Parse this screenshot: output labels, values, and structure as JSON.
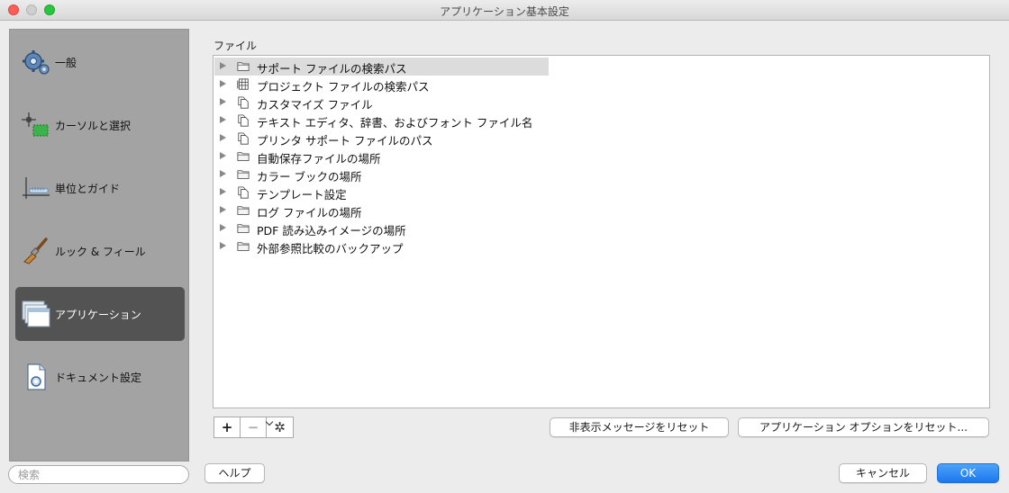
{
  "window": {
    "title": "アプリケーション基本設定"
  },
  "sidebar": {
    "items": [
      {
        "label": "一般",
        "icon": "gear-icon",
        "selected": false
      },
      {
        "label": "カーソルと選択",
        "icon": "cursor-selection-icon",
        "selected": false
      },
      {
        "label": "単位とガイド",
        "icon": "units-guides-icon",
        "selected": false
      },
      {
        "label": "ルック & フィール",
        "icon": "brush-icon",
        "selected": false
      },
      {
        "label": "アプリケーション",
        "icon": "application-windows-icon",
        "selected": true
      },
      {
        "label": "ドキュメント設定",
        "icon": "document-settings-icon",
        "selected": false
      }
    ],
    "search_placeholder": "検索"
  },
  "files": {
    "section_label": "ファイル",
    "rows": [
      {
        "label": "サポート ファイルの検索パス",
        "icon": "folder-icon",
        "selected": true
      },
      {
        "label": "プロジェクト ファイルの検索パス",
        "icon": "project-icon",
        "selected": false
      },
      {
        "label": "カスタマイズ ファイル",
        "icon": "files-icon",
        "selected": false
      },
      {
        "label": "テキスト エディタ、辞書、およびフォント ファイル名",
        "icon": "files-icon",
        "selected": false
      },
      {
        "label": "プリンタ サポート ファイルのパス",
        "icon": "files-icon",
        "selected": false
      },
      {
        "label": "自動保存ファイルの場所",
        "icon": "folder-icon",
        "selected": false
      },
      {
        "label": "カラー ブックの場所",
        "icon": "folder-icon",
        "selected": false
      },
      {
        "label": "テンプレート設定",
        "icon": "files-icon",
        "selected": false
      },
      {
        "label": "ログ ファイルの場所",
        "icon": "folder-icon",
        "selected": false
      },
      {
        "label": "PDF 読み込みイメージの場所",
        "icon": "folder-icon",
        "selected": false
      },
      {
        "label": "外部参照比較のバックアップ",
        "icon": "folder-icon",
        "selected": false
      }
    ]
  },
  "toolbar": {
    "add_label": "+",
    "remove_label": "−",
    "gear_label": "✲",
    "reset_hidden_messages_label": "非表示メッセージをリセット",
    "reset_app_options_label": "アプリケーション オプションをリセット..."
  },
  "footer": {
    "help_label": "ヘルプ",
    "cancel_label": "キャンセル",
    "ok_label": "OK"
  },
  "colors": {
    "accent": "#1b77ee",
    "sidebar_bg": "#a3a3a3",
    "sidebar_selected": "#535353"
  }
}
